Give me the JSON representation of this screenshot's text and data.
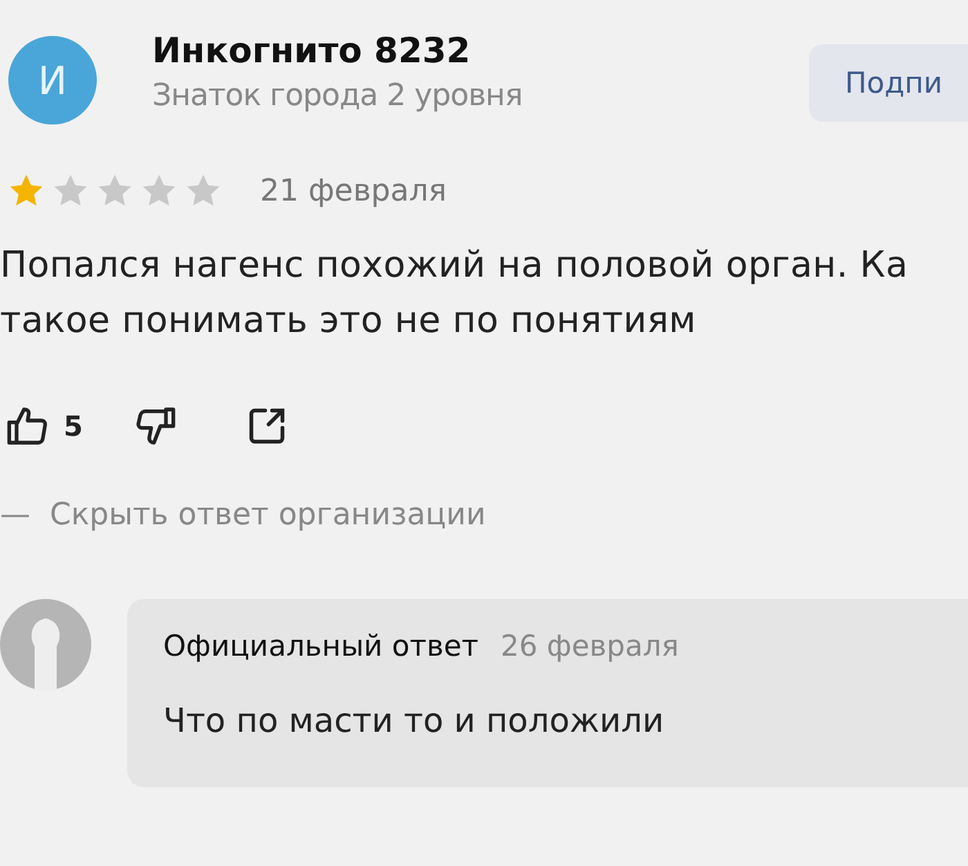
{
  "author": {
    "avatar_letter": "И",
    "name": "Инкогнито 8232",
    "level": "Знаток города 2 уровня"
  },
  "subscribe_button": "Подпи",
  "review": {
    "stars": 1,
    "date": "21 февраля",
    "lines": [
      "Попался нагенс похожий на половой орган. Ка",
      "такое понимать это не по понятиям"
    ]
  },
  "actions": {
    "likes": "5"
  },
  "toggle_reply": {
    "dash": "—",
    "label": "Скрыть ответ организации"
  },
  "reply": {
    "title": "Официальный ответ",
    "date": "26 февраля",
    "text": "Что по масти то и положили"
  }
}
